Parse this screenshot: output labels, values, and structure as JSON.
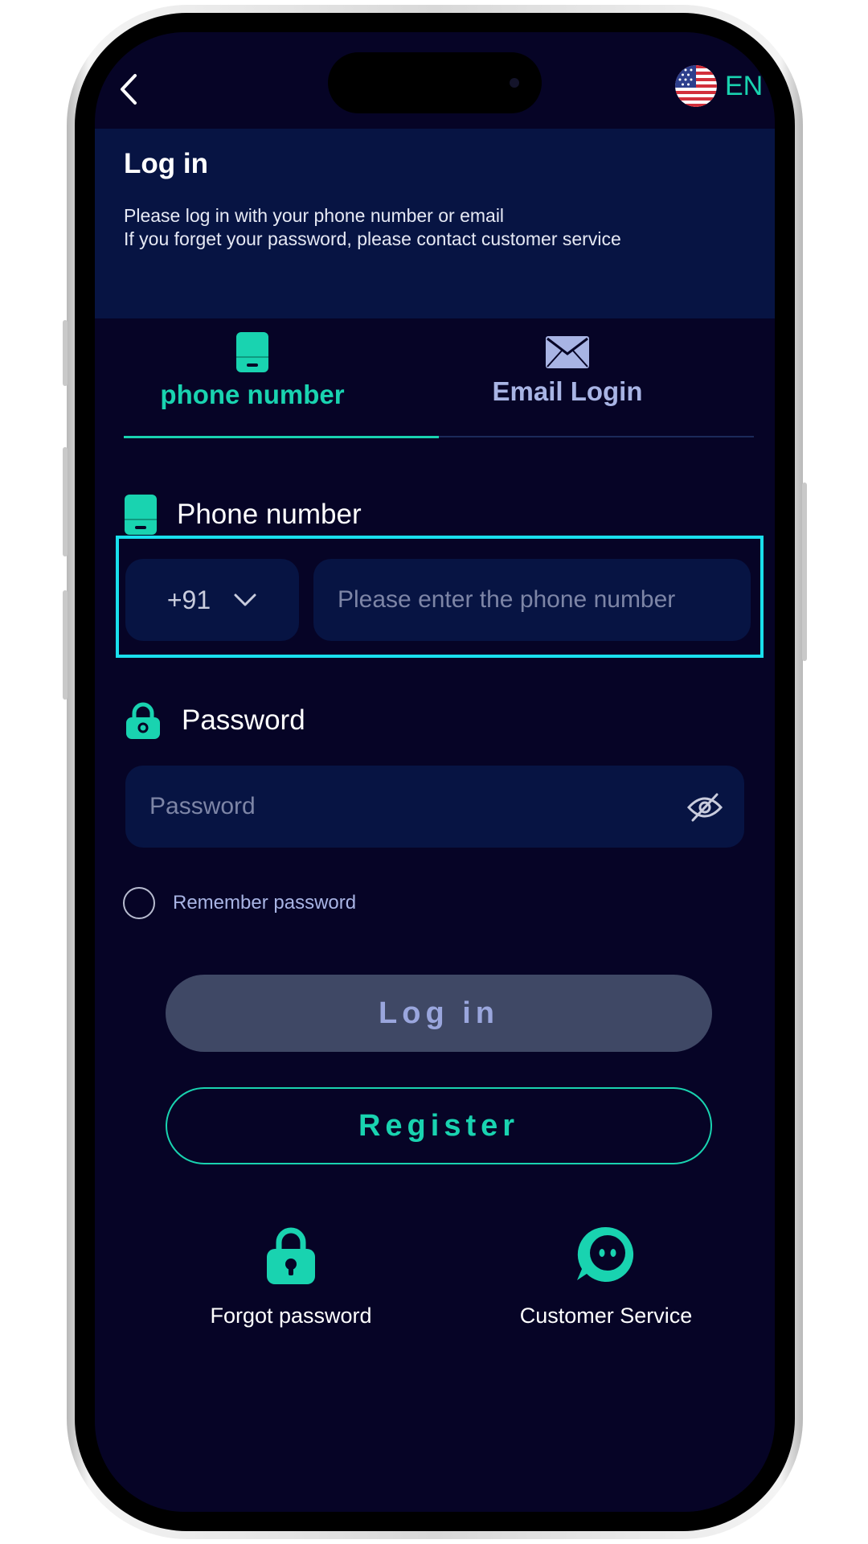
{
  "header": {
    "language": "EN",
    "title": "Log in",
    "subtitle_line1": "Please log in with your phone number or email",
    "subtitle_line2": "If you forget your password, please contact customer service"
  },
  "tabs": [
    {
      "label": "phone number",
      "active": true
    },
    {
      "label": "Email Login",
      "active": false
    }
  ],
  "phone_field": {
    "label": "Phone number",
    "country_code": "+91",
    "placeholder": "Please enter the phone number",
    "value": ""
  },
  "password_field": {
    "label": "Password",
    "placeholder": "Password",
    "value": ""
  },
  "remember": {
    "label": "Remember password",
    "checked": false
  },
  "buttons": {
    "login": "Log in",
    "register": "Register"
  },
  "bottom": {
    "forgot": "Forgot password",
    "service": "Customer Service"
  },
  "icons": {
    "back": "chevron-left-icon",
    "flag": "us-flag-icon",
    "phone_tab": "phone-icon",
    "email_tab": "envelope-icon",
    "phone_label": "phone-icon",
    "password_label": "lock-icon",
    "dropdown": "chevron-down-icon",
    "visibility": "eye-off-icon",
    "forgot": "lock-icon",
    "service": "chat-bubble-icon"
  },
  "colors": {
    "accent": "#19d3b0",
    "background": "#060426",
    "panel": "#071443",
    "inactive_tab": "#a8b4e4",
    "highlight": "#19e0ee",
    "login_button": "#3f4865"
  }
}
